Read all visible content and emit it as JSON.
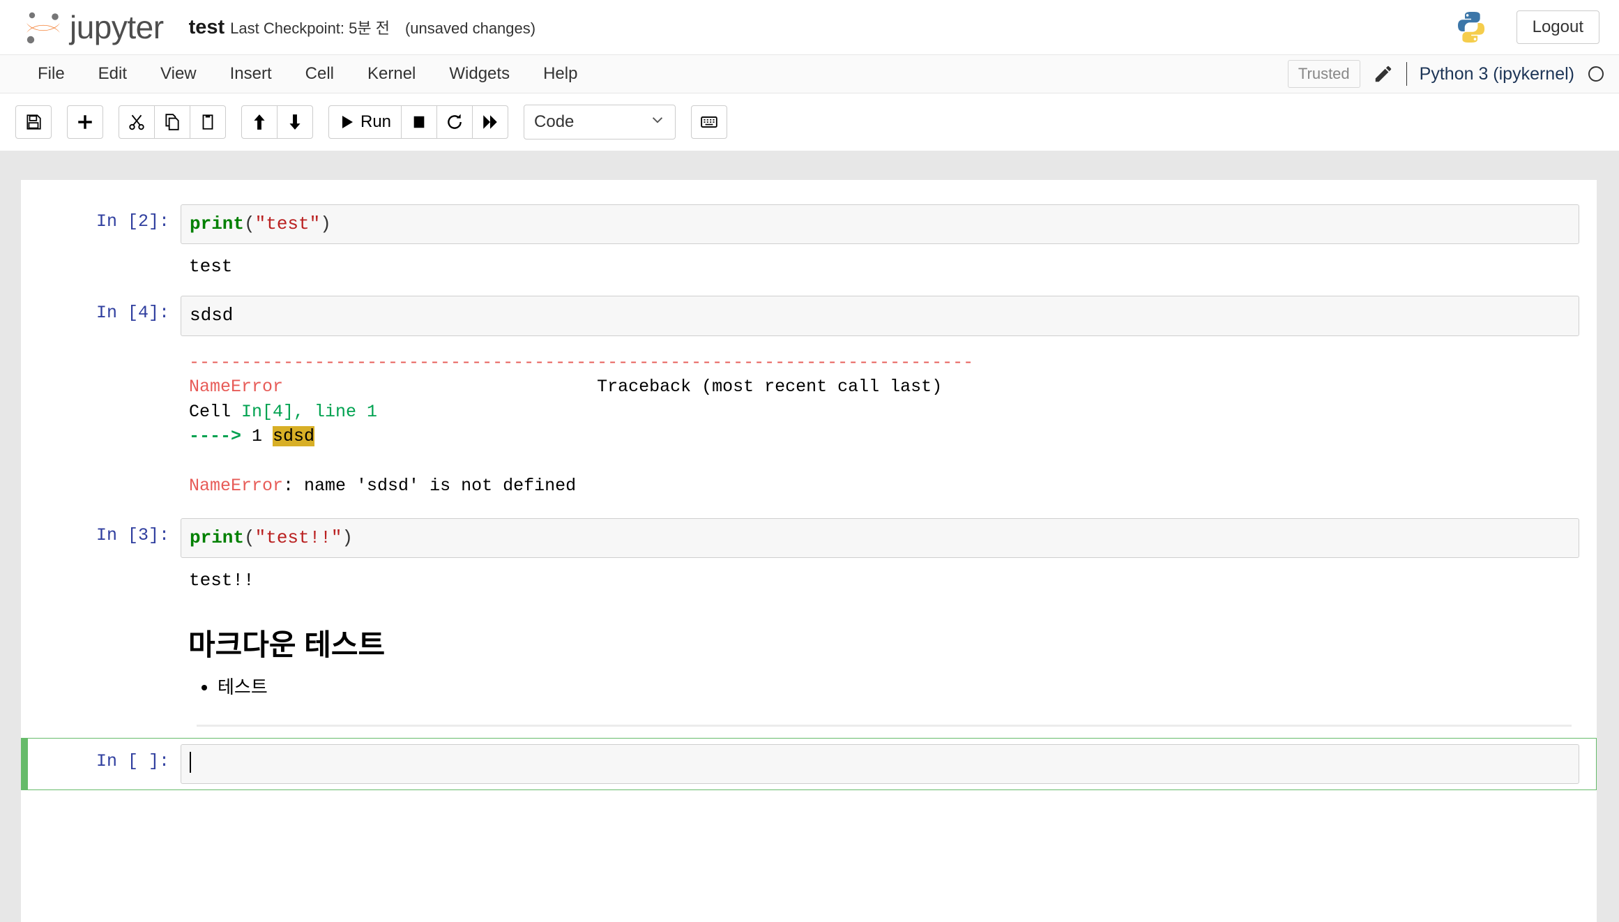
{
  "header": {
    "brand": "jupyter",
    "notebook_name": "test",
    "checkpoint": "Last Checkpoint: 5분 전",
    "dirty_state": "(unsaved changes)",
    "python_logo_icon": "python-logo-icon",
    "logout_label": "Logout"
  },
  "menubar": {
    "items": [
      {
        "label": "File"
      },
      {
        "label": "Edit"
      },
      {
        "label": "View"
      },
      {
        "label": "Insert"
      },
      {
        "label": "Cell"
      },
      {
        "label": "Kernel"
      },
      {
        "label": "Widgets"
      },
      {
        "label": "Help"
      }
    ],
    "trusted_label": "Trusted",
    "edit_icon": "pencil-icon",
    "kernel_name": "Python 3 (ipykernel)",
    "kernel_status_icon": "kernel-idle-circle-icon"
  },
  "toolbar": {
    "save_icon": "save-floppy-icon",
    "insert_below_icon": "plus-icon",
    "cut_icon": "scissors-icon",
    "copy_icon": "copy-icon",
    "paste_icon": "paste-icon",
    "move_up_icon": "arrow-up-icon",
    "move_down_icon": "arrow-down-icon",
    "run_icon": "play-icon",
    "run_label": "Run",
    "stop_icon": "stop-square-icon",
    "restart_icon": "restart-circle-arrow-icon",
    "restart_run_all_icon": "fast-forward-icon",
    "cell_type_value": "Code",
    "cell_type_chevron": "chevron-down-icon",
    "command_palette_icon": "keyboard-icon"
  },
  "notebook": {
    "cells": [
      {
        "type": "code",
        "prompt": "In [2]:",
        "source_segments": [
          {
            "text": "print",
            "cls": "tok-fn"
          },
          {
            "text": "(",
            "cls": "tok-p"
          },
          {
            "text": "\"test\"",
            "cls": "tok-str"
          },
          {
            "text": ")",
            "cls": "tok-p"
          }
        ],
        "output": "test"
      },
      {
        "type": "code",
        "prompt": "In [4]:",
        "source_plain": "sdsd",
        "traceback": {
          "rule": "---------------------------------------------------------------------------",
          "line2_error": "NameError",
          "line2_right": "Traceback (most recent call last)",
          "line3_cell": "Cell ",
          "line3_ref": "In[4], line 1",
          "line4_arrow": "----> ",
          "line4_num": "1 ",
          "line4_code": "sdsd",
          "final_error": "NameError",
          "final_message": ": name 'sdsd' is not defined"
        }
      },
      {
        "type": "code",
        "prompt": "In [3]:",
        "source_segments": [
          {
            "text": "print",
            "cls": "tok-fn"
          },
          {
            "text": "(",
            "cls": "tok-p"
          },
          {
            "text": "\"test!!\"",
            "cls": "tok-str"
          },
          {
            "text": ")",
            "cls": "tok-p"
          }
        ],
        "output": "test!!"
      },
      {
        "type": "markdown",
        "heading": "마크다운 테스트",
        "bullets": [
          "테스트"
        ]
      },
      {
        "type": "code",
        "prompt": "In [ ]:",
        "source_plain": "",
        "selected": true
      }
    ]
  }
}
